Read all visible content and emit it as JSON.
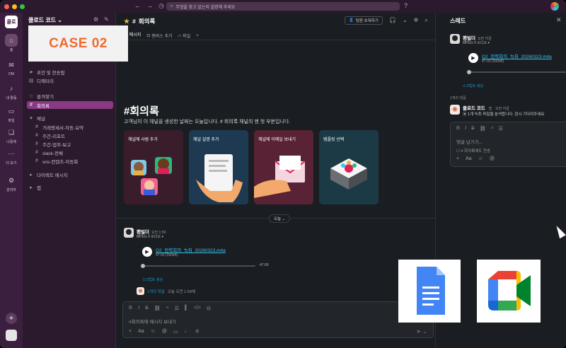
{
  "topbar": {
    "search_placeholder": "무엇을 찾고 있는지 설명해 주세요",
    "colors": {
      "close": "#ff5f57",
      "minimize": "#febc2e",
      "zoom": "#28c840"
    }
  },
  "rail": {
    "workspace_logo": "클로",
    "items": [
      {
        "label": "홈",
        "icon": "home-icon"
      },
      {
        "label": "DM",
        "icon": "dm-icon"
      },
      {
        "label": "내 활동",
        "icon": "bell-icon"
      },
      {
        "label": "파일",
        "icon": "file-icon"
      },
      {
        "label": "나중에",
        "icon": "bookmark-icon"
      },
      {
        "label": "더 보기",
        "icon": "more-icon"
      },
      {
        "label": "관리자",
        "icon": "gear-icon"
      }
    ]
  },
  "overlay": {
    "case_label": "CASE 02"
  },
  "sidebar": {
    "workspace_name": "클로드 코드",
    "top_items": [
      "초안 및 전송됨",
      "디렉터리"
    ],
    "favorites_header": "즐겨찾기",
    "favorites": [
      "회의록"
    ],
    "channels_header": "채널",
    "channels": [
      "거래명세서-자동-요약",
      "주간-리포트",
      "주간-업무-보고",
      "slack-전체",
      "sns-컨텐츠-자동화"
    ],
    "dm_header": "다이렉트 메시지",
    "apps_header": "앱"
  },
  "channel": {
    "name": "회의록",
    "invite_label": "팀원 초대하기",
    "tabs": [
      "메시지",
      "캔버스 추가",
      "파일"
    ],
    "big_title": "#회의록",
    "intro": "고객님이 이 채널을 생성한 날짜는 오늘입니다. # 회의록 채널의 맨 첫 부분입니다.",
    "cards": [
      {
        "label": "채널에 사람 추가",
        "bg": "#3a1d2a"
      },
      {
        "label": "채널 설명 추가",
        "bg": "#1e3a52"
      },
      {
        "label": "채널에 이메일 보내기",
        "bg": "#5a2235"
      },
      {
        "label": "템플릿 선택",
        "bg": "#1c3a45"
      }
    ],
    "date_divider": "오늘",
    "message": {
      "author": "팬빌더",
      "time": "오전 1:59",
      "sub": "MPEG 4 오디오",
      "file_name": "Q2_전략회의_녹취_20260323.m4a",
      "file_meta": "47:00 (990kB)",
      "duration": "47:00",
      "transcript_link": "스크립트 생성",
      "reply_count": "1개의 댓글",
      "reply_time": "오늘 오전 1:59에"
    },
    "composer_placeholder": "#회의록에 메시지 보내기"
  },
  "thread": {
    "title": "스레드",
    "root": {
      "author": "팬빌더",
      "time": "오전 지금",
      "sub": "MPEG 4 오디오",
      "file_name": "Q2_전략회의_녹취_20260323.m4a",
      "file_meta": "47:00 (990kB)",
      "transcript_link": "스크립트 생성"
    },
    "reply_count": "1개의 댓글",
    "reply": {
      "author": "클로드 코드",
      "badge": "앱",
      "time": "오전 지금",
      "text": "1개 녹취 파일을 분석합니다. 잠시 기다려주세요"
    },
    "composer_placeholder": "댓글 남기기...",
    "also_send": "# 회의록에도 전송"
  },
  "logos": {
    "docs": "google-docs-logo",
    "meet": "google-meet-logo"
  }
}
